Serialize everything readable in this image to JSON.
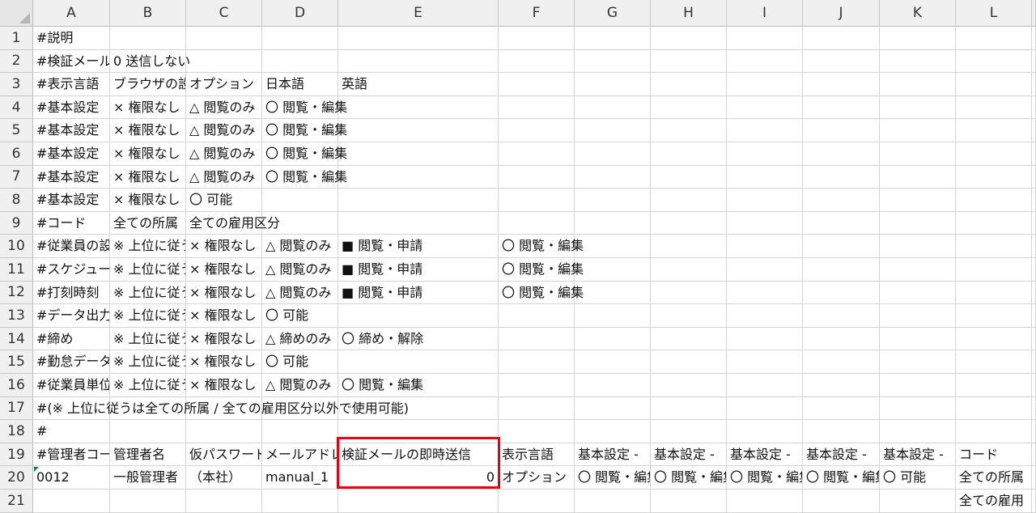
{
  "columns": [
    "A",
    "B",
    "C",
    "D",
    "E",
    "F",
    "G",
    "H",
    "I",
    "J",
    "K",
    "L"
  ],
  "rows": [
    "1",
    "2",
    "3",
    "4",
    "5",
    "6",
    "7",
    "8",
    "9",
    "10",
    "11",
    "12",
    "13",
    "14",
    "15",
    "16",
    "17",
    "18",
    "19",
    "20",
    "21"
  ],
  "cells": [
    {
      "id": "A1",
      "text": "#説明"
    },
    {
      "id": "A2",
      "text": "#検証メール"
    },
    {
      "id": "B2",
      "text": "0 送信しない"
    },
    {
      "id": "A3",
      "text": "#表示言語"
    },
    {
      "id": "B3",
      "text": "ブラウザの設定"
    },
    {
      "id": "C3",
      "text": "オプション"
    },
    {
      "id": "D3",
      "text": "日本語"
    },
    {
      "id": "E3",
      "text": "英語"
    },
    {
      "id": "A4",
      "text": "#基本設定"
    },
    {
      "id": "B4",
      "text": "× 権限なし"
    },
    {
      "id": "C4",
      "text": "△ 閲覧のみ"
    },
    {
      "id": "D4",
      "text": "〇 閲覧・編集"
    },
    {
      "id": "A5",
      "text": "#基本設定"
    },
    {
      "id": "B5",
      "text": "× 権限なし"
    },
    {
      "id": "C5",
      "text": "△ 閲覧のみ"
    },
    {
      "id": "D5",
      "text": "〇 閲覧・編集"
    },
    {
      "id": "A6",
      "text": "#基本設定"
    },
    {
      "id": "B6",
      "text": "× 権限なし"
    },
    {
      "id": "C6",
      "text": "△ 閲覧のみ"
    },
    {
      "id": "D6",
      "text": "〇 閲覧・編集"
    },
    {
      "id": "A7",
      "text": "#基本設定"
    },
    {
      "id": "B7",
      "text": "× 権限なし"
    },
    {
      "id": "C7",
      "text": "△ 閲覧のみ"
    },
    {
      "id": "D7",
      "text": "〇 閲覧・編集"
    },
    {
      "id": "A8",
      "text": "#基本設定"
    },
    {
      "id": "B8",
      "text": "× 権限なし"
    },
    {
      "id": "C8",
      "text": "〇 可能"
    },
    {
      "id": "A9",
      "text": "#コード"
    },
    {
      "id": "B9",
      "text": "全ての所属"
    },
    {
      "id": "C9",
      "text": "全ての雇用区分"
    },
    {
      "id": "A10",
      "text": "#従業員の設定"
    },
    {
      "id": "B10",
      "text": "※ 上位に従う"
    },
    {
      "id": "C10",
      "text": "× 権限なし"
    },
    {
      "id": "D10",
      "text": "△ 閲覧のみ"
    },
    {
      "id": "E10",
      "text": "■ 閲覧・申請"
    },
    {
      "id": "F10",
      "text": "〇 閲覧・編集"
    },
    {
      "id": "A11",
      "text": "#スケジュール"
    },
    {
      "id": "B11",
      "text": "※ 上位に従う"
    },
    {
      "id": "C11",
      "text": "× 権限なし"
    },
    {
      "id": "D11",
      "text": "△ 閲覧のみ"
    },
    {
      "id": "E11",
      "text": "■ 閲覧・申請"
    },
    {
      "id": "F11",
      "text": "〇 閲覧・編集"
    },
    {
      "id": "A12",
      "text": "#打刻時刻"
    },
    {
      "id": "B12",
      "text": "※ 上位に従う"
    },
    {
      "id": "C12",
      "text": "× 権限なし"
    },
    {
      "id": "D12",
      "text": "△ 閲覧のみ"
    },
    {
      "id": "E12",
      "text": "■ 閲覧・申請"
    },
    {
      "id": "F12",
      "text": "〇 閲覧・編集"
    },
    {
      "id": "A13",
      "text": "#データ出力"
    },
    {
      "id": "B13",
      "text": "※ 上位に従う"
    },
    {
      "id": "C13",
      "text": "× 権限なし"
    },
    {
      "id": "D13",
      "text": "〇 可能"
    },
    {
      "id": "A14",
      "text": "#締め"
    },
    {
      "id": "B14",
      "text": "※ 上位に従う"
    },
    {
      "id": "C14",
      "text": "× 権限なし"
    },
    {
      "id": "D14",
      "text": "△ 締めのみ"
    },
    {
      "id": "E14",
      "text": "〇 締め・解除"
    },
    {
      "id": "A15",
      "text": "#勤怠データ"
    },
    {
      "id": "B15",
      "text": "※ 上位に従う"
    },
    {
      "id": "C15",
      "text": "× 権限なし"
    },
    {
      "id": "D15",
      "text": "〇 可能"
    },
    {
      "id": "A16",
      "text": "#従業員単位"
    },
    {
      "id": "B16",
      "text": "※ 上位に従う"
    },
    {
      "id": "C16",
      "text": "× 権限なし"
    },
    {
      "id": "D16",
      "text": "△ 閲覧のみ"
    },
    {
      "id": "E16",
      "text": "〇 閲覧・編集"
    },
    {
      "id": "A17",
      "text": "#(※ 上位に従うは全ての所属 / 全ての雇用区分以外で使用可能)"
    },
    {
      "id": "A18",
      "text": "#"
    },
    {
      "id": "A19",
      "text": "#管理者コード"
    },
    {
      "id": "B19",
      "text": "管理者名"
    },
    {
      "id": "C19",
      "text": "仮パスワード"
    },
    {
      "id": "D19",
      "text": "メールアドレス"
    },
    {
      "id": "E19",
      "text": "検証メールの即時送信"
    },
    {
      "id": "F19",
      "text": "表示言語"
    },
    {
      "id": "G19",
      "text": "基本設定 -"
    },
    {
      "id": "H19",
      "text": "基本設定 -"
    },
    {
      "id": "I19",
      "text": "基本設定 -"
    },
    {
      "id": "J19",
      "text": "基本設定 -"
    },
    {
      "id": "K19",
      "text": "基本設定 -"
    },
    {
      "id": "L19",
      "text": "コード"
    },
    {
      "id": "A20",
      "text": "0012"
    },
    {
      "id": "B20",
      "text": "一般管理者"
    },
    {
      "id": "C20",
      "text": "（本社）"
    },
    {
      "id": "D20",
      "text": "manual_1"
    },
    {
      "id": "E20",
      "text": "0",
      "align": "right"
    },
    {
      "id": "F20",
      "text": "オプション"
    },
    {
      "id": "G20",
      "text": "〇 閲覧・編集"
    },
    {
      "id": "H20",
      "text": "〇 閲覧・編集"
    },
    {
      "id": "I20",
      "text": "〇 閲覧・編集"
    },
    {
      "id": "J20",
      "text": "〇 閲覧・編集"
    },
    {
      "id": "K20",
      "text": "〇 可能"
    },
    {
      "id": "L20",
      "text": "全ての所属"
    },
    {
      "id": "L21",
      "text": "全ての雇用"
    }
  ],
  "highlight_cell": "E19:E20",
  "colors": {
    "highlight": "#e60012",
    "error_indicator": "#0d7e3c"
  }
}
